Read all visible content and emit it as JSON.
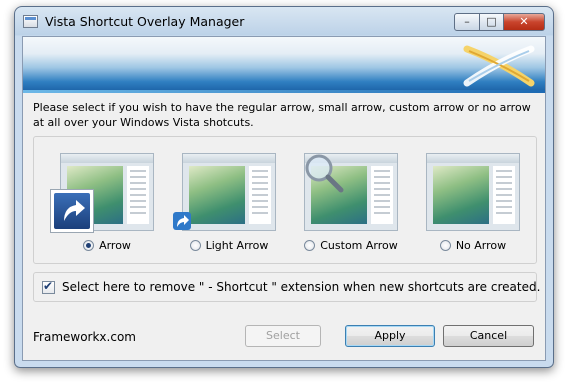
{
  "window": {
    "title": "Vista Shortcut Overlay Manager",
    "controls": {
      "minimize": "–",
      "maximize": "□",
      "close": "✕"
    }
  },
  "instructions": "Please select if you wish to have the regular arrow, small arrow, custom arrow or no arrow at all over your Windows Vista shotcuts.",
  "options": [
    {
      "label": "Arrow",
      "selected": true,
      "overlay": "large-shortcut-arrow-icon"
    },
    {
      "label": "Light Arrow",
      "selected": false,
      "overlay": "small-shortcut-arrow-icon"
    },
    {
      "label": "Custom Arrow",
      "selected": false,
      "overlay": "magnifier-icon"
    },
    {
      "label": "No Arrow",
      "selected": false,
      "overlay": "none"
    }
  ],
  "checkbox": {
    "label": "Select here to remove \" - Shortcut \" extension when new shortcuts are created.",
    "checked": true
  },
  "footer": {
    "site": "Frameworkx.com"
  },
  "buttons": {
    "select": "Select",
    "apply": "Apply",
    "cancel": "Cancel"
  },
  "colors": {
    "banner_blue": "#1a5ea3",
    "selected_radio": "#1f3f74",
    "close_button": "#c9442c"
  }
}
